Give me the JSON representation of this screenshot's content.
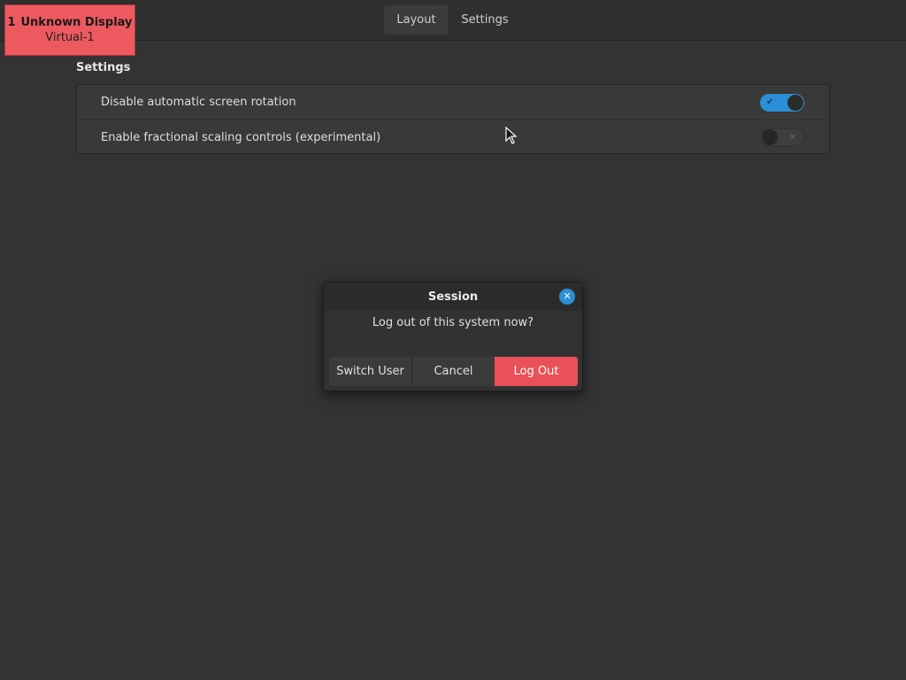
{
  "topbar": {
    "tabs": [
      {
        "label": "Layout"
      },
      {
        "label": "Settings"
      }
    ]
  },
  "display_badge": {
    "number": "1",
    "name": "Unknown Display",
    "connector": "Virtual-1",
    "color": "#ec5a5f"
  },
  "settings": {
    "section_title": "Settings",
    "rows": [
      {
        "label": "Disable automatic screen rotation",
        "toggle_on": true,
        "toggle_glyph": "✔"
      },
      {
        "label": "Enable fractional scaling controls (experimental)",
        "toggle_on": false,
        "toggle_glyph": "×"
      }
    ]
  },
  "dialog": {
    "title": "Session",
    "close_icon": "close-icon",
    "message": "Log out of this system now?",
    "buttons": {
      "switch_user": "Switch User",
      "cancel": "Cancel",
      "log_out": "Log Out"
    },
    "accent": "#e95057"
  },
  "colors": {
    "background": "#333333",
    "toggle_on": "#2a8fd6"
  }
}
